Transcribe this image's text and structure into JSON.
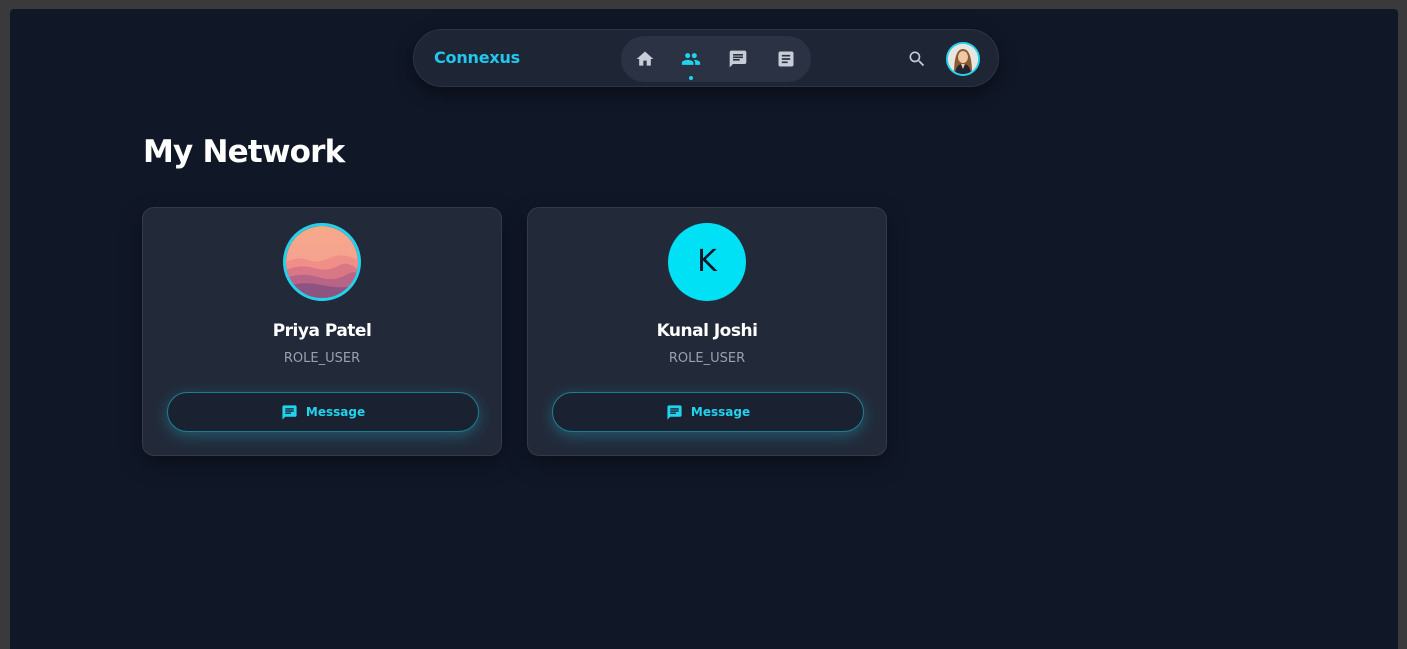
{
  "app": {
    "brand": "Connexus"
  },
  "nav": {
    "items": [
      {
        "name": "home",
        "icon": "home-icon",
        "active": false
      },
      {
        "name": "network",
        "icon": "people-icon",
        "active": true
      },
      {
        "name": "messages",
        "icon": "chat-icon",
        "active": false
      },
      {
        "name": "posts",
        "icon": "article-icon",
        "active": false
      }
    ],
    "search_icon": "search-icon",
    "profile_avatar": "user-avatar"
  },
  "page": {
    "title": "My Network"
  },
  "connections": [
    {
      "name": "Priya Patel",
      "role": "ROLE_USER",
      "avatar_type": "photo",
      "button_label": "Message",
      "button_icon": "message-icon"
    },
    {
      "name": "Kunal Joshi",
      "role": "ROLE_USER",
      "avatar_type": "initial",
      "initial": "K",
      "button_label": "Message",
      "button_icon": "message-icon"
    }
  ],
  "colors": {
    "background": "#101727",
    "card": "#222a3a",
    "accent": "#22d3ee",
    "initial_avatar": "#00e1f5",
    "text_primary": "#ffffff",
    "text_muted": "#9aa1ad",
    "icon_inactive": "#c7ccd6"
  }
}
